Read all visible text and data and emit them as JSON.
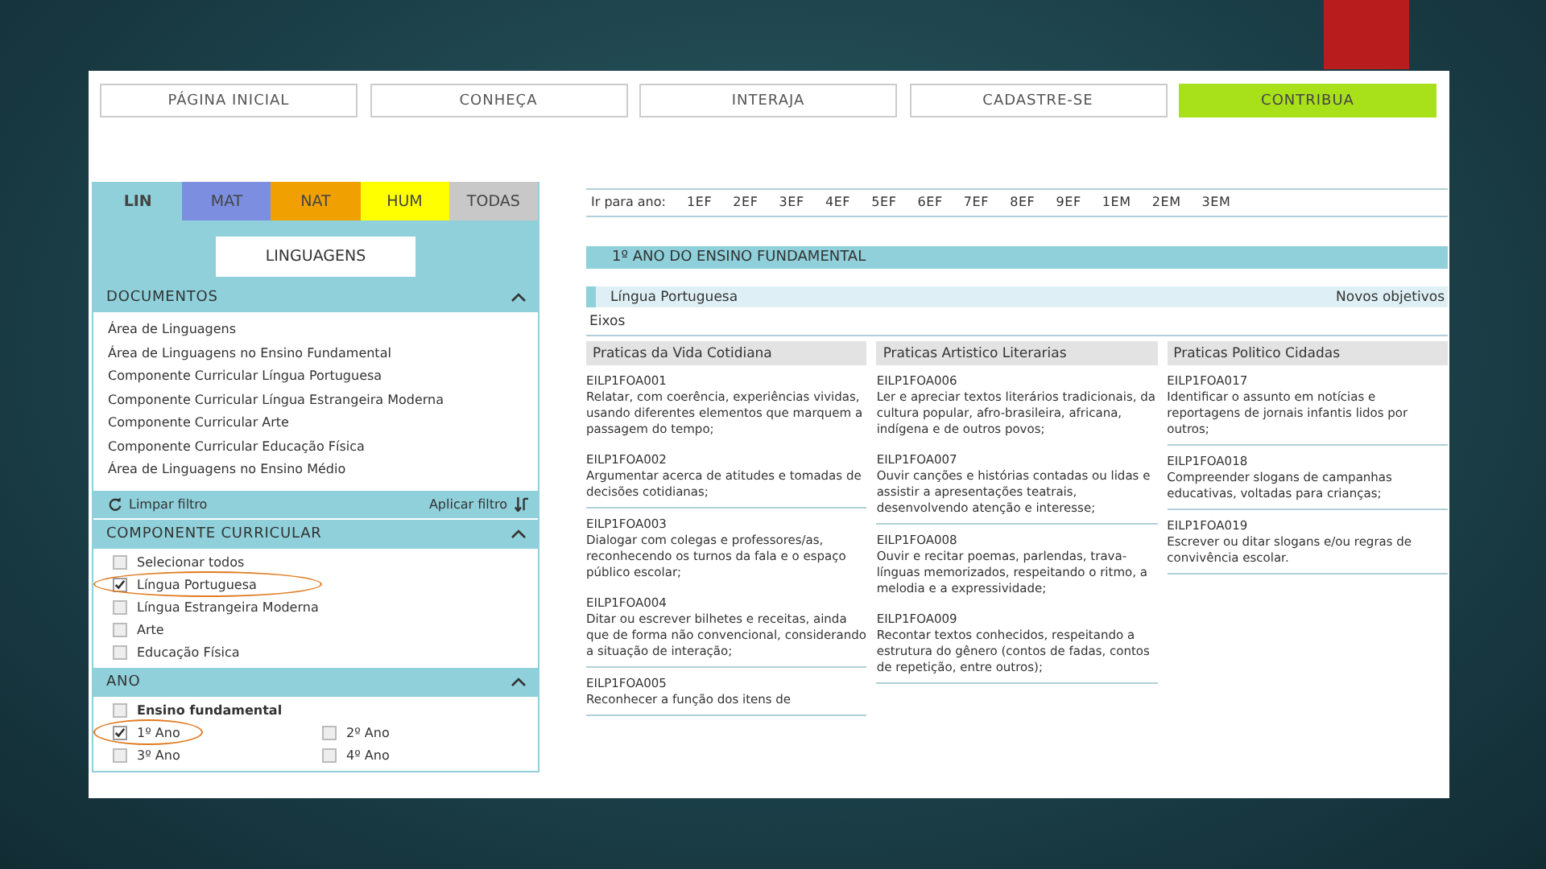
{
  "nav": [
    {
      "label": "PÁGINA INICIAL",
      "selected": false
    },
    {
      "label": "CONHEÇA",
      "selected": false
    },
    {
      "label": "INTERAJA",
      "selected": false
    },
    {
      "label": "CADASTRE-SE",
      "selected": false
    },
    {
      "label": "CONTRIBUA",
      "selected": true
    }
  ],
  "sidebar": {
    "area_tabs": [
      {
        "label": "LIN",
        "color": "#8fd0da",
        "selected": true
      },
      {
        "label": "MAT",
        "color": "#7b8ee0",
        "selected": false
      },
      {
        "label": "NAT",
        "color": "#f0a000",
        "selected": false
      },
      {
        "label": "HUM",
        "color": "#ffff00",
        "selected": false
      },
      {
        "label": "TODAS",
        "color": "#c8c8c8",
        "selected": false
      }
    ],
    "area_title": "LINGUAGENS",
    "sections": [
      {
        "kind": "links",
        "title": "DOCUMENTOS",
        "expanded": true,
        "items": [
          {
            "label": "Área de Linguagens"
          },
          {
            "label": "Área de Linguagens no Ensino Fundamental"
          },
          {
            "label": "Componente Curricular Língua Portuguesa"
          },
          {
            "label": "Componente Curricular Língua Estrangeira Moderna"
          },
          {
            "label": "Componente Curricular Arte"
          },
          {
            "label": "Componente Curricular Educação Física"
          },
          {
            "label": "Área de Linguagens no Ensino Médio"
          }
        ]
      },
      {
        "kind": "filter",
        "clear": "Limpar filtro",
        "apply": "Aplicar filtro"
      },
      {
        "kind": "checks",
        "title": "COMPONENTE CURRICULAR",
        "expanded": true,
        "items": [
          {
            "label": "Selecionar todos",
            "checked": false,
            "circled": false
          },
          {
            "label": "Língua Portuguesa",
            "checked": true,
            "circled": true
          },
          {
            "label": "Língua Estrangeira Moderna",
            "checked": false,
            "circled": false
          },
          {
            "label": "Arte",
            "checked": false,
            "circled": false
          },
          {
            "label": "Educação Física",
            "checked": false,
            "circled": false
          }
        ]
      },
      {
        "kind": "years",
        "title": "ANO",
        "expanded": true,
        "group": {
          "label": "Ensino fundamental",
          "checked": false
        },
        "items": [
          {
            "label": "1º Ano",
            "checked": true,
            "circled": true
          },
          {
            "label": "2º Ano",
            "checked": false,
            "circled": false
          },
          {
            "label": "3º Ano",
            "checked": false,
            "circled": false
          },
          {
            "label": "4º Ano",
            "checked": false,
            "circled": false
          }
        ]
      }
    ]
  },
  "content": {
    "year_nav_label": "Ir para ano:",
    "years": [
      "1EF",
      "2EF",
      "3EF",
      "4EF",
      "5EF",
      "6EF",
      "7EF",
      "8EF",
      "9EF",
      "1EM",
      "2EM",
      "3EM"
    ],
    "heading": "1º ANO DO ENSINO FUNDAMENTAL",
    "subject": "Língua Portuguesa",
    "new_objectives": "Novos objetivos",
    "axes_label": "Eixos",
    "columns": [
      {
        "title": "Praticas da Vida Cotidiana",
        "groups": [
          [
            {
              "code": "EILP1FOA001",
              "text": "Relatar, com coerência, experiências vividas, usando diferentes elementos que marquem a passagem do tempo;"
            },
            {
              "code": "EILP1FOA002",
              "text": "Argumentar acerca de atitudes e tomadas de decisões cotidianas;"
            }
          ],
          [
            {
              "code": "EILP1FOA003",
              "text": "Dialogar com colegas e professores/as, reconhecendo os turnos da fala e o espaço público escolar;"
            },
            {
              "code": "EILP1FOA004",
              "text": "Ditar ou escrever bilhetes e receitas, ainda que de forma não convencional, considerando a situação de interação;"
            }
          ],
          [
            {
              "code": "EILP1FOA005",
              "text": "Reconhecer a função dos itens de"
            }
          ]
        ]
      },
      {
        "title": "Praticas Artistico Literarias",
        "groups": [
          [
            {
              "code": "EILP1FOA006",
              "text": "Ler e apreciar textos literários tradicionais, da cultura popular, afro-brasileira, africana, indígena e de outros povos;"
            },
            {
              "code": "EILP1FOA007",
              "text": "Ouvir canções e histórias contadas ou lidas e assistir a apresentações teatrais, desenvolvendo atenção e interesse;"
            }
          ],
          [
            {
              "code": "EILP1FOA008",
              "text": "Ouvir e recitar poemas, parlendas, trava-línguas memorizados, respeitando o ritmo, a melodia e a expressividade;"
            },
            {
              "code": "EILP1FOA009",
              "text": "Recontar textos conhecidos, respeitando a estrutura do gênero (contos de fadas, contos de repetição, entre outros);"
            }
          ]
        ]
      },
      {
        "title": "Praticas Politico Cidadas",
        "groups": [
          [
            {
              "code": "EILP1FOA017",
              "text": "Identificar o assunto em notícias e reportagens de jornais infantis lidos por outros;"
            }
          ],
          [
            {
              "code": "EILP1FOA018",
              "text": "Compreender slogans de campanhas educativas, voltadas para crianças;"
            }
          ],
          [
            {
              "code": "EILP1FOA019",
              "text": "Escrever ou ditar slogans e/ou regras de convivência escolar."
            }
          ]
        ]
      }
    ]
  }
}
